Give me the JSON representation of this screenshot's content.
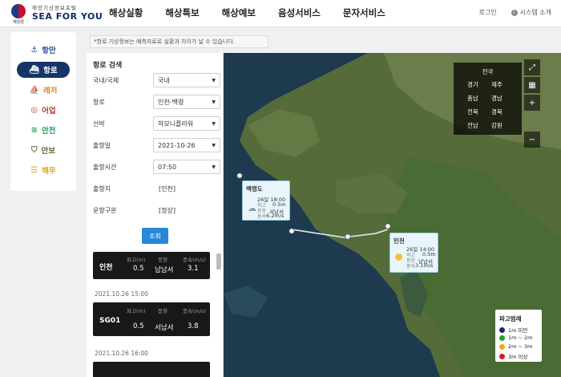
{
  "header": {
    "agency": "해양경",
    "logo_sub": "해양기상정보포털",
    "logo_main": "SEA FOR YOU",
    "nav": [
      "해상실황",
      "해상특보",
      "해상예보",
      "음성서비스",
      "문자서비스"
    ],
    "login": "로그인",
    "site_intro": "시스템 소개"
  },
  "sidebar": {
    "items": [
      {
        "label": "항만",
        "icon": "⚓",
        "color": "#2a4a9a"
      },
      {
        "label": "항로",
        "icon": "⛴",
        "color": "#ffffff"
      },
      {
        "label": "레저",
        "icon": "⛵",
        "color": "#e08a1e"
      },
      {
        "label": "어업",
        "icon": "🐟",
        "color": "#c0392b"
      },
      {
        "label": "안전",
        "icon": "📶",
        "color": "#1e9e5a"
      },
      {
        "label": "안보",
        "icon": "🛡",
        "color": "#5a6a3a"
      },
      {
        "label": "해무",
        "icon": "☰",
        "color": "#e0a81e"
      }
    ]
  },
  "notice": "*항로 기상정보는 예측자료로 실황과 차이가 날 수 있습니다.",
  "panel": {
    "title": "항로 검색",
    "fields": [
      {
        "label": "국내/국제",
        "value": "국내",
        "type": "select"
      },
      {
        "label": "항로",
        "value": "인천-백령",
        "type": "select"
      },
      {
        "label": "선박",
        "value": "하모니플라워",
        "type": "select"
      },
      {
        "label": "출항일",
        "value": "2021-10-26",
        "type": "select"
      },
      {
        "label": "출항시간",
        "value": "07:50",
        "type": "select"
      },
      {
        "label": "출항지",
        "value": "[인천]",
        "type": "text"
      },
      {
        "label": "운항구분",
        "value": "[정상]",
        "type": "text"
      }
    ],
    "search_label": "조회",
    "col_headers": [
      "파고(m)",
      "풍향",
      "풍속(m/s)"
    ],
    "cards": [
      {
        "station": "인천",
        "wave": "0.5",
        "dir": "남남서",
        "speed": "3.1"
      },
      {
        "station": "SG01",
        "wave": "0.5",
        "dir": "서남서",
        "speed": "3.8"
      }
    ],
    "timestamps": [
      "2021.10.26 15:00",
      "2021.10.26 16:00"
    ]
  },
  "map": {
    "region": {
      "all": "전국",
      "cells": [
        "경기",
        "제주",
        "충남",
        "경남",
        "전북",
        "경북",
        "전남",
        "강원"
      ]
    },
    "popup_baekryeong": {
      "name": "백령도",
      "time": "26일 18:00",
      "labels": [
        "파고",
        "풍향",
        "풍속"
      ],
      "values": [
        "0.5m",
        "서남서",
        "6.2m/s"
      ]
    },
    "popup_incheon": {
      "name": "인천",
      "time": "26일 14:00",
      "labels": [
        "파고",
        "풍향",
        "풍속"
      ],
      "values": [
        "0.5m",
        "남남서",
        "3.1m/s"
      ]
    },
    "legend": {
      "title": "파고범례",
      "items": [
        {
          "label": "1m 미만",
          "color": "#1a2a6e"
        },
        {
          "label": "1m ~ 2m",
          "color": "#2aa02a"
        },
        {
          "label": "2m ~ 3m",
          "color": "#e8a81e"
        },
        {
          "label": "3m 이상",
          "color": "#d21e1e"
        }
      ]
    }
  }
}
